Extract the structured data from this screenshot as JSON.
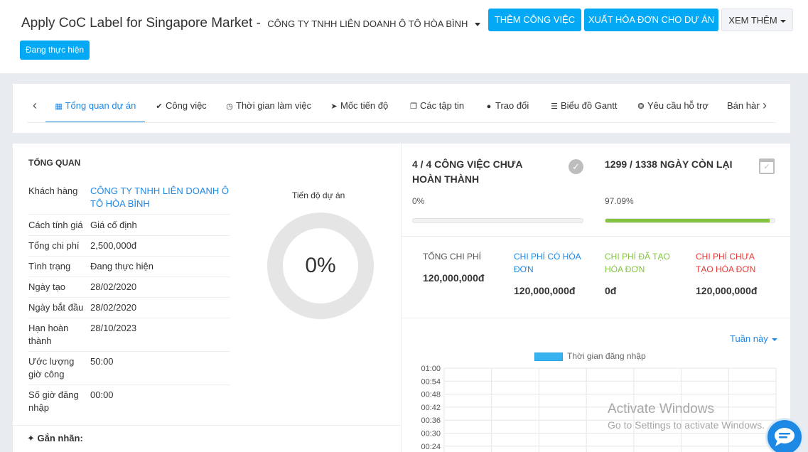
{
  "header": {
    "project_title": "Apply CoC Label for Singapore Market",
    "separator": "-",
    "company": "CÔNG TY TNHH LIÊN DOANH Ô TÔ HÒA BÌNH",
    "status": "Đang thực hiện",
    "buttons": {
      "add_task": "THÊM CÔNG VIỆC",
      "invoice": "XUẤT HÓA ĐƠN CHO DỰ ÁN",
      "more": "XEM THÊM"
    }
  },
  "tabs": [
    {
      "label": "Tổng quan dự án",
      "icon": "grid-icon",
      "active": true
    },
    {
      "label": "Công việc",
      "icon": "check-circle-icon"
    },
    {
      "label": "Thời gian làm việc",
      "icon": "clock-icon"
    },
    {
      "label": "Mốc tiến độ",
      "icon": "rocket-icon"
    },
    {
      "label": "Các tập tin",
      "icon": "files-icon"
    },
    {
      "label": "Trao đổi",
      "icon": "comment-icon"
    },
    {
      "label": "Biểu đồ Gantt",
      "icon": "list-icon"
    },
    {
      "label": "Yêu cầu hỗ trợ",
      "icon": "life-ring-icon"
    },
    {
      "label": "Bán hàng",
      "icon": ""
    }
  ],
  "overview": {
    "title": "TỔNG QUAN",
    "rows": [
      {
        "label": "Khách hàng",
        "value": "CÔNG TY TNHH LIÊN DOANH Ô TÔ HÒA BÌNH"
      },
      {
        "label": "Cách tính giá",
        "value": "Giá cố định"
      },
      {
        "label": "Tổng chi phí",
        "value": "2,500,000đ"
      },
      {
        "label": "Tình trạng",
        "value": "Đang thực hiện"
      },
      {
        "label": "Ngày tạo",
        "value": "28/02/2020"
      },
      {
        "label": "Ngày bắt đầu",
        "value": "28/02/2020"
      },
      {
        "label": "Hạn hoàn thành",
        "value": "28/10/2023"
      },
      {
        "label": "Ước lượng giờ công",
        "value": "50:00"
      },
      {
        "label": "Số giờ đăng nhập",
        "value": "00:00"
      }
    ],
    "progress_title": "Tiến độ dự án",
    "progress_value": "0%",
    "tags_label": "Gắn nhãn:"
  },
  "stats": {
    "tasks_title": "4 / 4 CÔNG VIỆC CHƯA HOÀN THÀNH",
    "tasks_pct": "0%",
    "tasks_fraction": 0,
    "days_title": "1299 / 1338 NGÀY CÒN LẠI",
    "days_pct": "97.09%",
    "days_fraction": 0.9709
  },
  "costs": {
    "total_label": "TỔNG CHI PHÍ",
    "total_value": "120,000,000đ",
    "billable_label": "CHI PHÍ CÓ HÓA ĐƠN",
    "billable_value": "120,000,000đ",
    "billed_label": "CHI PHÍ ĐÃ TẠO HÓA ĐƠN",
    "billed_value": "0đ",
    "unbilled_label": "CHI PHÍ CHƯA TẠO HÓA ĐƠN",
    "unbilled_value": "120,000,000đ",
    "colors": {
      "billable": "#1e88e5",
      "billed": "#84c441",
      "unbilled": "#e53935"
    }
  },
  "chart": {
    "filter_label": "Tuần này",
    "legend": "Thời gian đăng nhập",
    "y_ticks": [
      "01:00",
      "00:54",
      "00:48",
      "00:42",
      "00:36",
      "00:30",
      "00:24"
    ]
  },
  "watermark": {
    "line1": "Activate Windows",
    "line2": "Go to Settings to activate Windows."
  }
}
